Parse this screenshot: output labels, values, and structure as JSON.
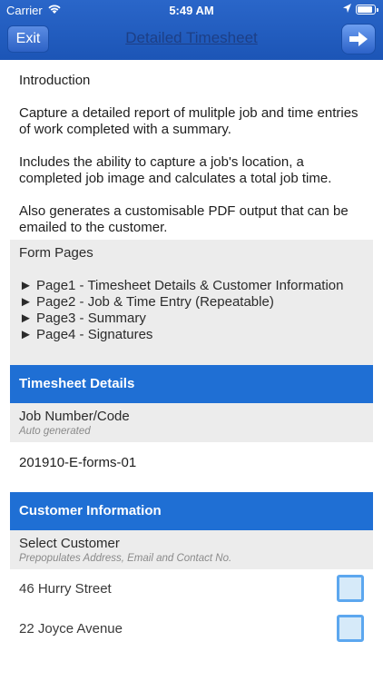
{
  "status_bar": {
    "carrier": "Carrier",
    "time": "5:49 AM"
  },
  "nav": {
    "exit_label": "Exit",
    "title": "Detailed Timesheet"
  },
  "intro": {
    "heading": "Introduction",
    "para1": "Capture a detailed report of mulitple job and time entries of work completed with a summary.",
    "para2": "Includes the ability to capture a job's location, a completed job image and calculates a total job time.",
    "para3": "Also generates a customisable PDF output that can be emailed to the customer."
  },
  "form_pages": {
    "title": "Form Pages",
    "items": [
      "► Page1 - Timesheet Details & Customer Information",
      "► Page2 - Job & Time Entry (Repeatable)",
      "► Page3 - Summary",
      "► Page4 - Signatures"
    ]
  },
  "timesheet_details": {
    "title": "Timesheet Details",
    "job_number": {
      "label": "Job Number/Code",
      "hint": "Auto generated",
      "value": "201910-E-forms-01"
    }
  },
  "customer_information": {
    "title": "Customer Information",
    "select_customer": {
      "label": "Select Customer",
      "hint": "Prepopulates Address, Email and Contact No."
    },
    "options": [
      {
        "label": "46 Hurry Street",
        "checked": false
      },
      {
        "label": "22 Joyce Avenue",
        "checked": false
      }
    ]
  },
  "colors": {
    "nav_bar": "#1c55b6",
    "section_header": "#1f6fd4",
    "checkbox_border": "#5ca7ef"
  },
  "icons": {
    "wifi": "wifi-icon",
    "location": "location-arrow-icon",
    "battery": "battery-icon",
    "next": "arrow-right-icon"
  }
}
